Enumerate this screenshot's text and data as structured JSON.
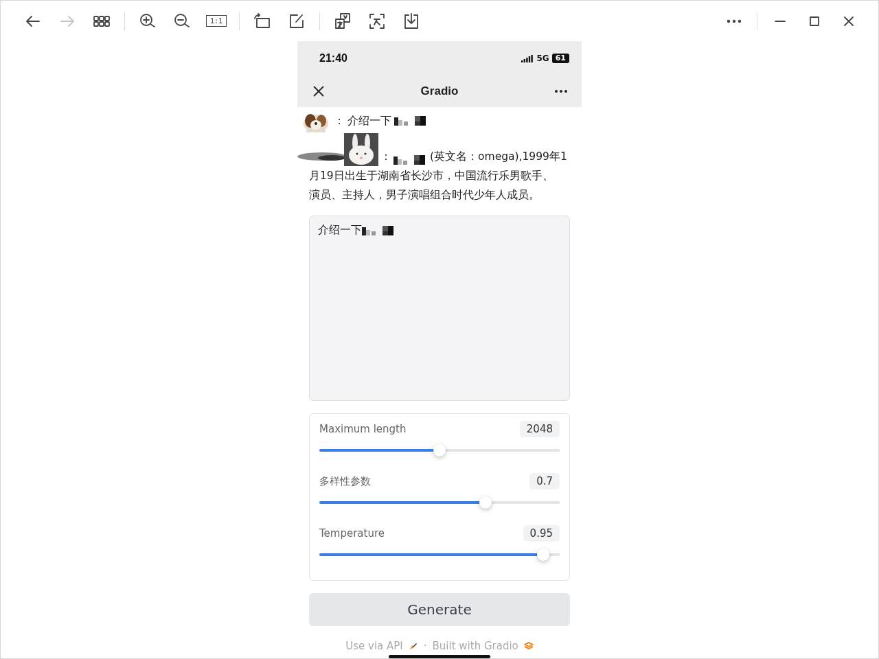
{
  "toolbar": {
    "left": [
      {
        "kind": "back",
        "disabled": false
      },
      {
        "kind": "forward",
        "disabled": true
      },
      {
        "kind": "grid",
        "disabled": false
      },
      {
        "kind": "separator"
      },
      {
        "kind": "zoom_in",
        "disabled": false
      },
      {
        "kind": "zoom_out",
        "disabled": false
      },
      {
        "kind": "actual_size",
        "label": "1:1",
        "disabled": false
      },
      {
        "kind": "separator"
      },
      {
        "kind": "rotate",
        "disabled": false
      },
      {
        "kind": "edit",
        "disabled": false
      },
      {
        "kind": "separator"
      },
      {
        "kind": "translate",
        "disabled": false
      },
      {
        "kind": "scan_translate",
        "disabled": false
      },
      {
        "kind": "download",
        "disabled": false
      }
    ],
    "right": [
      {
        "kind": "more",
        "disabled": false
      },
      {
        "kind": "separator"
      },
      {
        "kind": "minimize",
        "disabled": false
      },
      {
        "kind": "maximize",
        "disabled": false
      },
      {
        "kind": "close",
        "disabled": false
      }
    ]
  },
  "phone": {
    "status_bar": {
      "time": "21:40",
      "network": "5G",
      "battery": "61"
    },
    "nav_bar": {
      "title": "Gradio"
    },
    "chat": [
      {
        "kind": "user",
        "prefix": "：",
        "text": "介绍一下",
        "redacted": true
      },
      {
        "kind": "bot",
        "prefix": "：",
        "lines": [
          "(英文名：omega),1999年1",
          "月19日出生于湖南省长沙市，中国流行乐男歌手、",
          "演员、主持人，男子演唱组合时代少年人成员。"
        ],
        "redacted": true
      }
    ],
    "input": {
      "value": "介绍一下",
      "redacted": true
    },
    "sliders": [
      {
        "label": "Maximum length",
        "value": "2048",
        "level": 0.5
      },
      {
        "label": "多样性参数",
        "value": "0.7",
        "level": 0.69
      },
      {
        "label": "Temperature",
        "value": "0.95",
        "level": 0.93
      }
    ],
    "button": "Generate",
    "footer": {
      "api_link": "Use via API",
      "separator": "·",
      "built_with": "Built with Gradio"
    }
  }
}
